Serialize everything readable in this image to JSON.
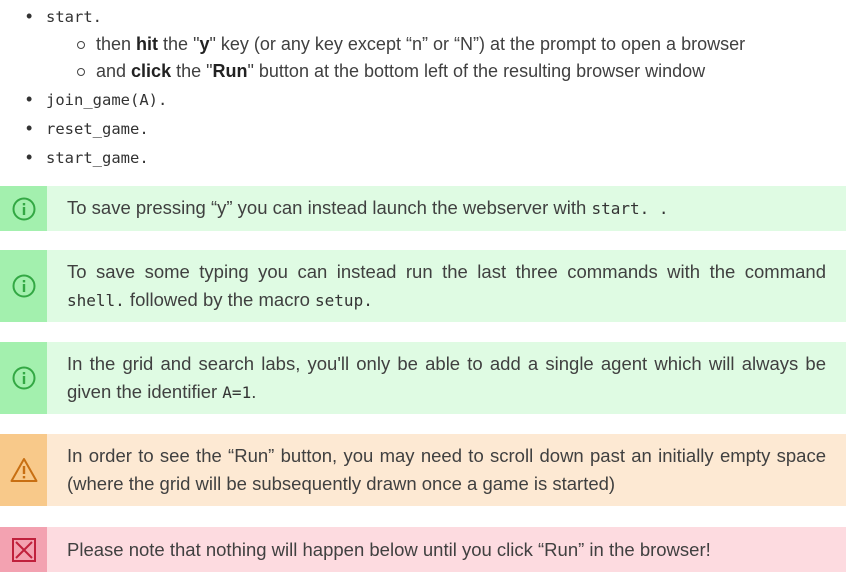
{
  "list": {
    "item1": "start.",
    "item1_sub1": {
      "pre": "then ",
      "bold1": "hit",
      "mid": " the \"",
      "bold2": "y",
      "post": "\" key (or any key except “n” or “N”) at the prompt to open a browser"
    },
    "item1_sub2": {
      "pre": "and ",
      "bold1": "click",
      "mid": " the \"",
      "bold2": "Run",
      "post": "\" button at the bottom left of the resulting browser window"
    },
    "item2": "join_game(A).",
    "item3": "reset_game.",
    "item4": "start_game."
  },
  "notes": {
    "n1": {
      "type": "info",
      "icon": "info-circle-icon",
      "pre": "To save pressing “y” you can instead launch the webserver with ",
      "code": "start. .",
      "post": ""
    },
    "n2": {
      "type": "info",
      "icon": "info-circle-icon",
      "pre": "To save some typing you can instead run the last three commands with the command ",
      "code1": "shell.",
      "mid": " followed by the macro ",
      "code2": "setup.",
      "post": ""
    },
    "n3": {
      "type": "info",
      "icon": "info-circle-icon",
      "pre": "In the grid and search labs, you'll only be able to add a single agent which will always be given the identifier ",
      "code": "A=1",
      "post": "."
    },
    "n4": {
      "type": "warning",
      "icon": "warning-triangle-icon",
      "text": "In order to see the “Run” button, you may need to scroll down past an initially empty space (where the grid will be subsequently drawn once a game is started)"
    },
    "n5": {
      "type": "danger",
      "icon": "cross-box-icon",
      "text": "Please note that nothing will happen below until you click “Run” in the browser!"
    }
  },
  "colors": {
    "info_bg": "#dffbe3",
    "info_bar": "#a3f0ae",
    "info_icon": "#33a844",
    "warn_bg": "#fde9d3",
    "warn_bar": "#f8c98a",
    "warn_icon": "#c86f12",
    "err_bg": "#fddbe0",
    "err_bar": "#f3a2b1",
    "err_icon": "#c0203c"
  }
}
